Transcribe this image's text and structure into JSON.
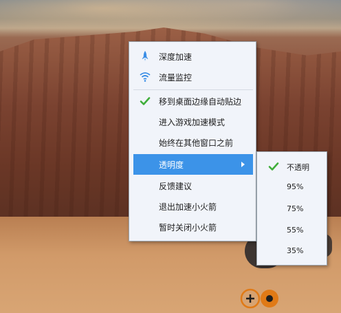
{
  "menu": {
    "items": [
      {
        "label": "深度加速",
        "icon": "rocket-icon"
      },
      {
        "label": "流量监控",
        "icon": "wifi-icon"
      },
      {
        "label": "移到桌面边缘自动贴边",
        "icon": "check-icon",
        "checked": true
      },
      {
        "label": "进入游戏加速模式"
      },
      {
        "label": "始终在其他窗口之前"
      },
      {
        "label": "透明度",
        "highlighted": true,
        "has_submenu": true
      },
      {
        "label": "反馈建议"
      },
      {
        "label": "退出加速小火箭"
      },
      {
        "label": "暂时关闭小火箭"
      }
    ]
  },
  "submenu": {
    "items": [
      {
        "label": "不透明",
        "checked": true
      },
      {
        "label": "95%"
      },
      {
        "label": "75%"
      },
      {
        "label": "55%"
      },
      {
        "label": "35%"
      }
    ]
  },
  "colors": {
    "highlight": "#3c93e8",
    "check": "#3fae3a",
    "icon_blue": "#3a8ee6"
  }
}
